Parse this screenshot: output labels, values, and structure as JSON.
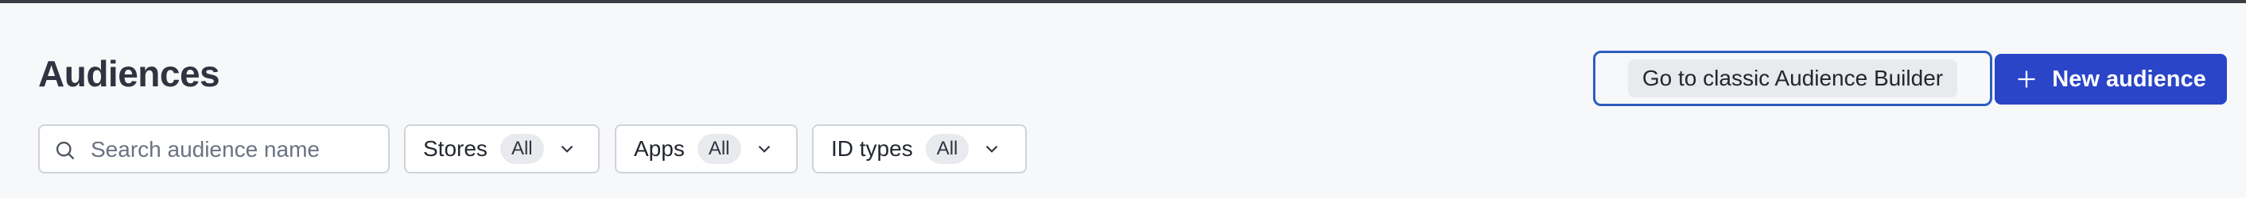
{
  "page": {
    "title": "Audiences"
  },
  "search": {
    "placeholder": "Search audience name",
    "value": ""
  },
  "filters": [
    {
      "label": "Stores",
      "value": "All"
    },
    {
      "label": "Apps",
      "value": "All"
    },
    {
      "label": "ID types",
      "value": "All"
    }
  ],
  "actions": {
    "classic_label": "Go to classic Audience Builder",
    "new_label": "New audience"
  },
  "icons": {
    "search": "search-icon",
    "chevron": "chevron-down-icon",
    "plus": "plus-icon"
  },
  "colors": {
    "primary": "#2a45c7",
    "focus_border": "#2f5dbd",
    "background": "#f7f8fa",
    "text": "#2f3440"
  }
}
